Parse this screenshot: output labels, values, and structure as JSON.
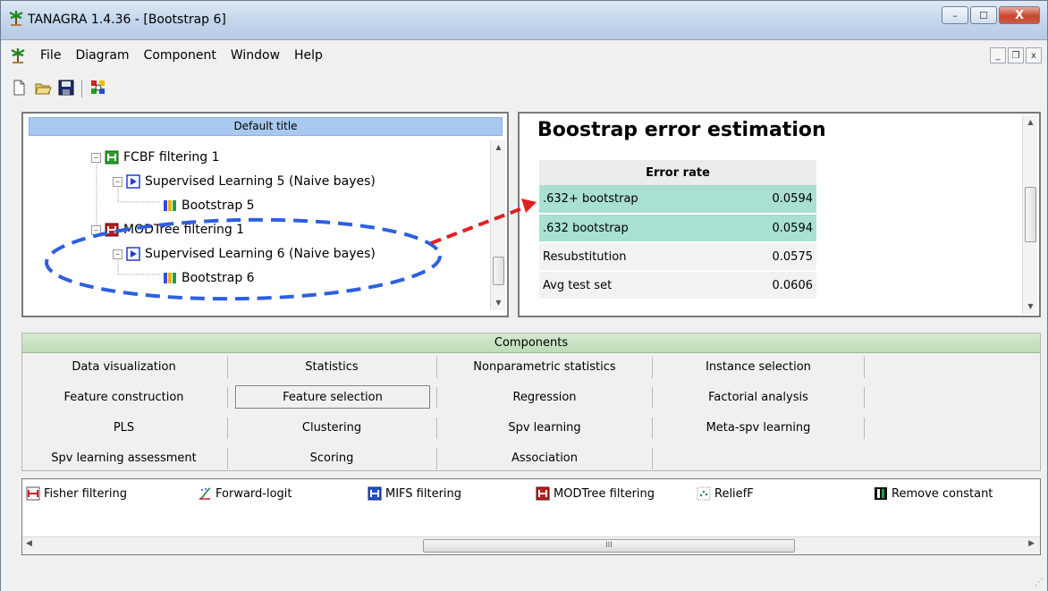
{
  "window": {
    "title": "TANAGRA 1.4.36 - [Bootstrap 6]",
    "controls": {
      "minimize": "–",
      "maximize": "☐",
      "close": "X"
    }
  },
  "menubar": {
    "items": [
      "File",
      "Diagram",
      "Component",
      "Window",
      "Help"
    ],
    "mdi_controls": {
      "minimize": "_",
      "restore": "❐",
      "close": "x"
    }
  },
  "toolbar": {
    "buttons": [
      "new-icon",
      "open-icon",
      "save-icon",
      "execute-icon"
    ]
  },
  "diagram": {
    "header": "Default title",
    "tree": [
      {
        "label": "FCBF filtering 1",
        "icon": "filter-icon",
        "color": "#2e9e2e"
      },
      {
        "label": "Supervised Learning 5 (Naive bayes)",
        "icon": "play-icon",
        "color": "#1f3fd4"
      },
      {
        "label": "Bootstrap 5",
        "icon": "bootstrap-icon",
        "color": "#2b8a3e"
      },
      {
        "label": "MODTree filtering 1",
        "icon": "filter-icon",
        "color": "#b22222"
      },
      {
        "label": "Supervised Learning 6 (Naive bayes)",
        "icon": "play-icon",
        "color": "#1f3fd4"
      },
      {
        "label": "Bootstrap 6",
        "icon": "bootstrap-icon",
        "color": "#2b8a3e"
      }
    ]
  },
  "result": {
    "title": "Boostrap error estimation",
    "column_header": "Error rate",
    "rows": [
      {
        "label": ".632+ bootstrap",
        "value": "0.0594",
        "highlight": true
      },
      {
        "label": ".632 bootstrap",
        "value": "0.0594",
        "highlight": true
      },
      {
        "label": "Resubstitution",
        "value": "0.0575",
        "highlight": false
      },
      {
        "label": "Avg test set",
        "value": "0.0606",
        "highlight": false
      }
    ]
  },
  "components": {
    "header": "Components",
    "tabs_row1": [
      "Data visualization",
      "Statistics",
      "Nonparametric statistics",
      "Instance selection"
    ],
    "tabs_row2": [
      "Feature construction",
      "Feature selection",
      "Regression",
      "Factorial analysis"
    ],
    "tabs_row3": [
      "PLS",
      "Clustering",
      "Spv learning",
      "Meta-spv learning"
    ],
    "tabs_row4": [
      "Spv learning assessment",
      "Scoring",
      "Association"
    ],
    "active_tab": "Feature selection",
    "items": [
      {
        "label": "Fisher filtering",
        "icon": "fisher-icon"
      },
      {
        "label": "Forward-logit",
        "icon": "forward-logit-icon"
      },
      {
        "label": "MIFS filtering",
        "icon": "mifs-icon"
      },
      {
        "label": "MODTree filtering",
        "icon": "modtree-icon"
      },
      {
        "label": "ReliefF",
        "icon": "relieff-icon"
      },
      {
        "label": "Remove constant",
        "icon": "remove-constant-icon"
      }
    ],
    "scroll_thumb_grip": "III"
  },
  "colors": {
    "highlight_row": "#a8e0d2",
    "header_blue": "#a7c9ef",
    "components_green": "#c6e3c0",
    "annotation_blue": "#2e5fe0",
    "annotation_red": "#e02020"
  }
}
